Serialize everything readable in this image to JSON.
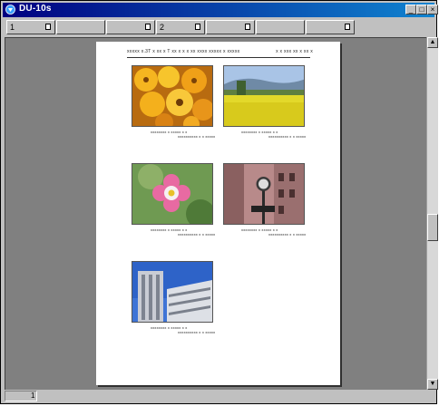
{
  "window": {
    "title": "DU-10s",
    "minimize": "_",
    "maximize": "□",
    "close": "×"
  },
  "toolbar": {
    "buttons": [
      {
        "num": "1"
      },
      {
        "num": ""
      },
      {
        "num": ""
      },
      {
        "num": "2"
      },
      {
        "num": ""
      },
      {
        "num": ""
      },
      {
        "num": ""
      }
    ]
  },
  "page": {
    "header_left": "xxxxx x.3T  x xx x  T xx x  x x  xx xxxx xxxxx x xxxxx",
    "header_right": "x x xxx  xx x xx x",
    "photos": [
      {
        "name": "orange-flowers",
        "caption1": "xxxxxxxx x xxxxx x x",
        "caption2": "xxxxxxxxxx x x xxxxx"
      },
      {
        "name": "yellow-field",
        "caption1": "xxxxxxxx x xxxxx x x",
        "caption2": "xxxxxxxxxx x x xxxxx"
      },
      {
        "name": "pink-flower",
        "caption1": "xxxxxxxx x xxxxx x x",
        "caption2": "xxxxxxxxxx x x xxxxx"
      },
      {
        "name": "street-clock",
        "caption1": "xxxxxxxx x xxxxx x x",
        "caption2": "xxxxxxxxxx x x xxxxx"
      },
      {
        "name": "office-buildings",
        "caption1": "xxxxxxxx x xxxxx x x",
        "caption2": "xxxxxxxxxx x x xxxxx"
      }
    ]
  },
  "scrollbar": {
    "up": "▲",
    "down": "▼"
  },
  "status": {
    "page_number": "1"
  }
}
